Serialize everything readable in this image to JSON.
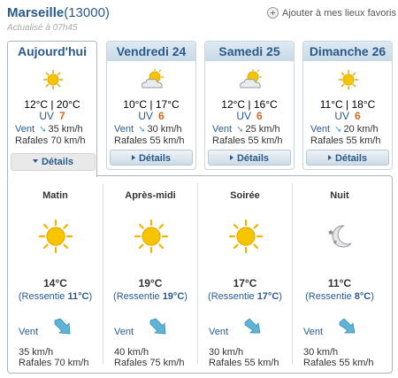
{
  "header": {
    "city": "Marseille",
    "postal_code": "(13000)",
    "updated": "Actualisé à 07h45",
    "favorite_label": "Ajouter à mes lieux favoris"
  },
  "days": [
    {
      "name": "Aujourd'hui",
      "icon": "sun-icon",
      "temps": "12°C | 20°C",
      "uv_label": "UV",
      "uv": "7",
      "wind_label": "Vent",
      "wind": "35 km/h",
      "gust": "Rafales 70 km/h",
      "details_label": "Détails",
      "active": true
    },
    {
      "name": "Vendredi 24",
      "icon": "partly-cloudy-icon",
      "temps": "10°C | 17°C",
      "uv_label": "UV",
      "uv": "6",
      "wind_label": "Vent",
      "wind": "30 km/h",
      "gust": "Rafales 55 km/h",
      "details_label": "Détails"
    },
    {
      "name": "Samedi 25",
      "icon": "partly-cloudy-icon",
      "temps": "12°C | 16°C",
      "uv_label": "UV",
      "uv": "6",
      "wind_label": "Vent",
      "wind": "25 km/h",
      "gust": "Rafales 55 km/h",
      "details_label": "Détails"
    },
    {
      "name": "Dimanche 26",
      "icon": "sun-icon",
      "temps": "11°C | 18°C",
      "uv_label": "UV",
      "uv": "6",
      "wind_label": "Vent",
      "wind": "20 km/h",
      "gust": "Rafales 55 km/h",
      "details_label": "Détails"
    }
  ],
  "periods": [
    {
      "name": "Matin",
      "icon": "sun-icon",
      "temp": "14°C",
      "feel_prefix": "(Ressentie ",
      "feel": "11°C",
      "feel_suffix": ")",
      "wind_label": "Vent",
      "speed": "35 km/h",
      "gust": "Rafales 70 km/h"
    },
    {
      "name": "Après-midi",
      "icon": "sun-icon",
      "temp": "19°C",
      "feel_prefix": "(Ressentie ",
      "feel": "19°C",
      "feel_suffix": ")",
      "wind_label": "Vent",
      "speed": "40 km/h",
      "gust": "Rafales 75 km/h"
    },
    {
      "name": "Soirée",
      "icon": "sun-icon",
      "temp": "17°C",
      "feel_prefix": "(Ressentie ",
      "feel": "17°C",
      "feel_suffix": ")",
      "wind_label": "Vent",
      "speed": "30 km/h",
      "gust": "Rafales 55 km/h"
    },
    {
      "name": "Nuit",
      "icon": "moon-icon",
      "temp": "11°C",
      "feel_prefix": "(Ressentie ",
      "feel": "8°C",
      "feel_suffix": ")",
      "wind_label": "Vent",
      "speed": "30 km/h",
      "gust": "Rafales 55 km/h"
    }
  ],
  "colors": {
    "accent": "#2a5a8c",
    "uv": "#d2691e",
    "sun": "#f7c400",
    "wind_arrow": "#4a9ec8"
  }
}
